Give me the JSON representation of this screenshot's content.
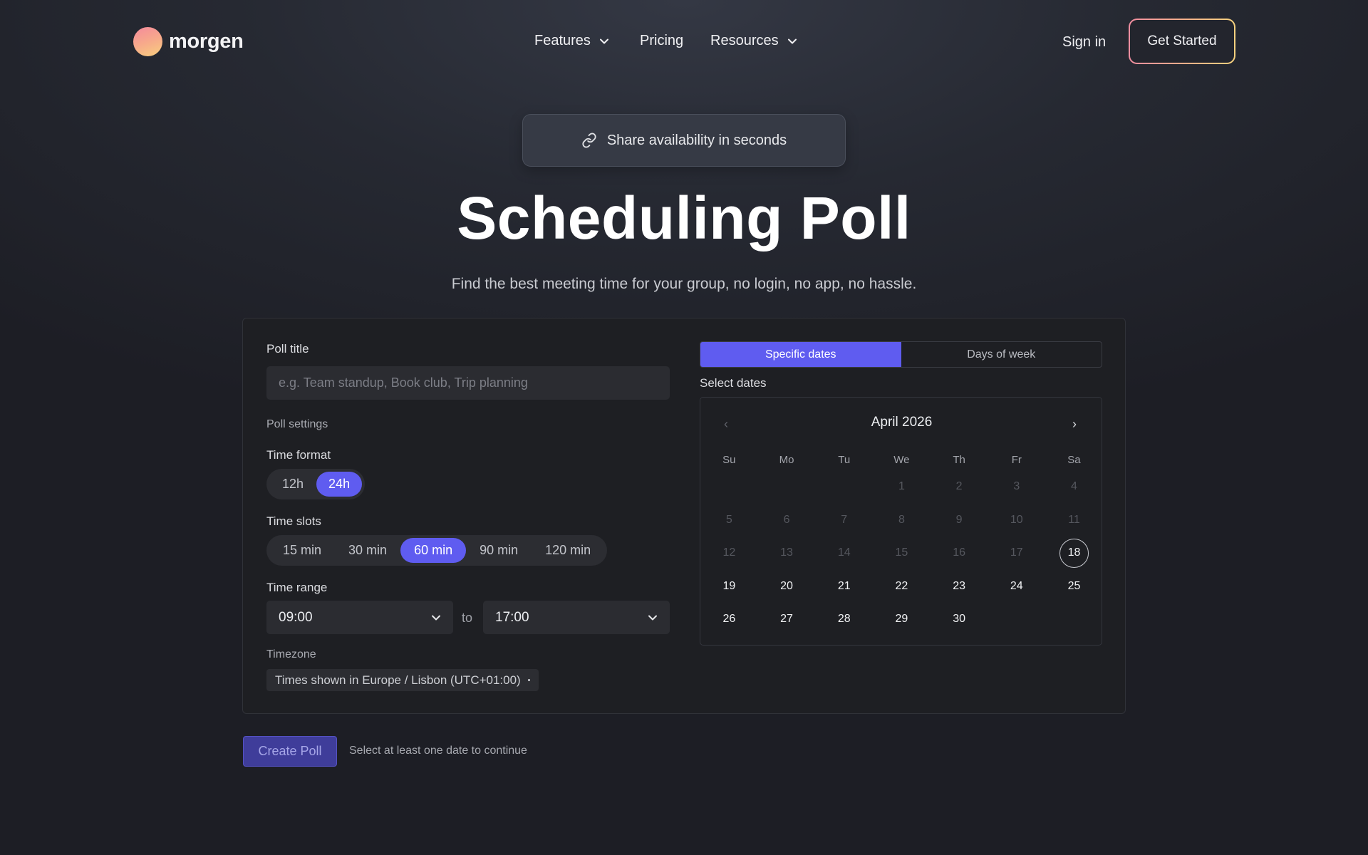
{
  "nav": {
    "brand": "morgen",
    "links": [
      {
        "label": "Features",
        "has_dropdown": true
      },
      {
        "label": "Pricing",
        "has_dropdown": false
      },
      {
        "label": "Resources",
        "has_dropdown": true
      }
    ],
    "sign_in": "Sign in",
    "cta": "Get Started"
  },
  "hero": {
    "badge": "Share availability in seconds",
    "badge_icon": "link-icon",
    "title": "Scheduling Poll",
    "subtitle": "Find the best meeting time for your group, no login, no app, no hassle."
  },
  "form": {
    "poll_title_label": "Poll title",
    "poll_title_value": "",
    "poll_title_placeholder": "e.g. Team standup, Book club, Trip planning",
    "settings_heading": "Poll settings",
    "time_format": {
      "label": "Time format",
      "options": [
        "12h",
        "24h"
      ],
      "selected": "24h"
    },
    "time_slots": {
      "label": "Time slots",
      "options": [
        "15 min",
        "30 min",
        "60 min",
        "90 min",
        "120 min"
      ],
      "selected": "60 min"
    },
    "time_range": {
      "label": "Time range",
      "start": "09:00",
      "separator": "to",
      "end": "17:00"
    },
    "timezone": {
      "label": "Timezone",
      "value": "Times shown in Europe / Lisbon (UTC+01:00)"
    }
  },
  "dates": {
    "mode_tabs": [
      "Specific dates",
      "Days of week"
    ],
    "active_mode": "Specific dates",
    "select_label": "Select dates",
    "calendar": {
      "month": "April 2026",
      "weekdays": [
        "Su",
        "Mo",
        "Tu",
        "We",
        "Th",
        "Fr",
        "Sa"
      ],
      "weeks": [
        [
          null,
          null,
          null,
          1,
          2,
          3,
          4
        ],
        [
          5,
          6,
          7,
          8,
          9,
          10,
          11
        ],
        [
          12,
          13,
          14,
          15,
          16,
          17,
          18
        ],
        [
          19,
          20,
          21,
          22,
          23,
          24,
          25
        ],
        [
          26,
          27,
          28,
          29,
          30,
          null,
          null
        ]
      ],
      "today": 18,
      "first_selectable": 18,
      "selected_days": []
    }
  },
  "footer": {
    "create_button": "Create Poll",
    "helper_text": "Select at least one date to continue"
  },
  "colors": {
    "accent": "#5f5cf0",
    "background": "#1d1e25",
    "card": "#1e1f23",
    "brand_gradient_start": "#f48a9c",
    "brand_gradient_end": "#f8cf7e"
  }
}
